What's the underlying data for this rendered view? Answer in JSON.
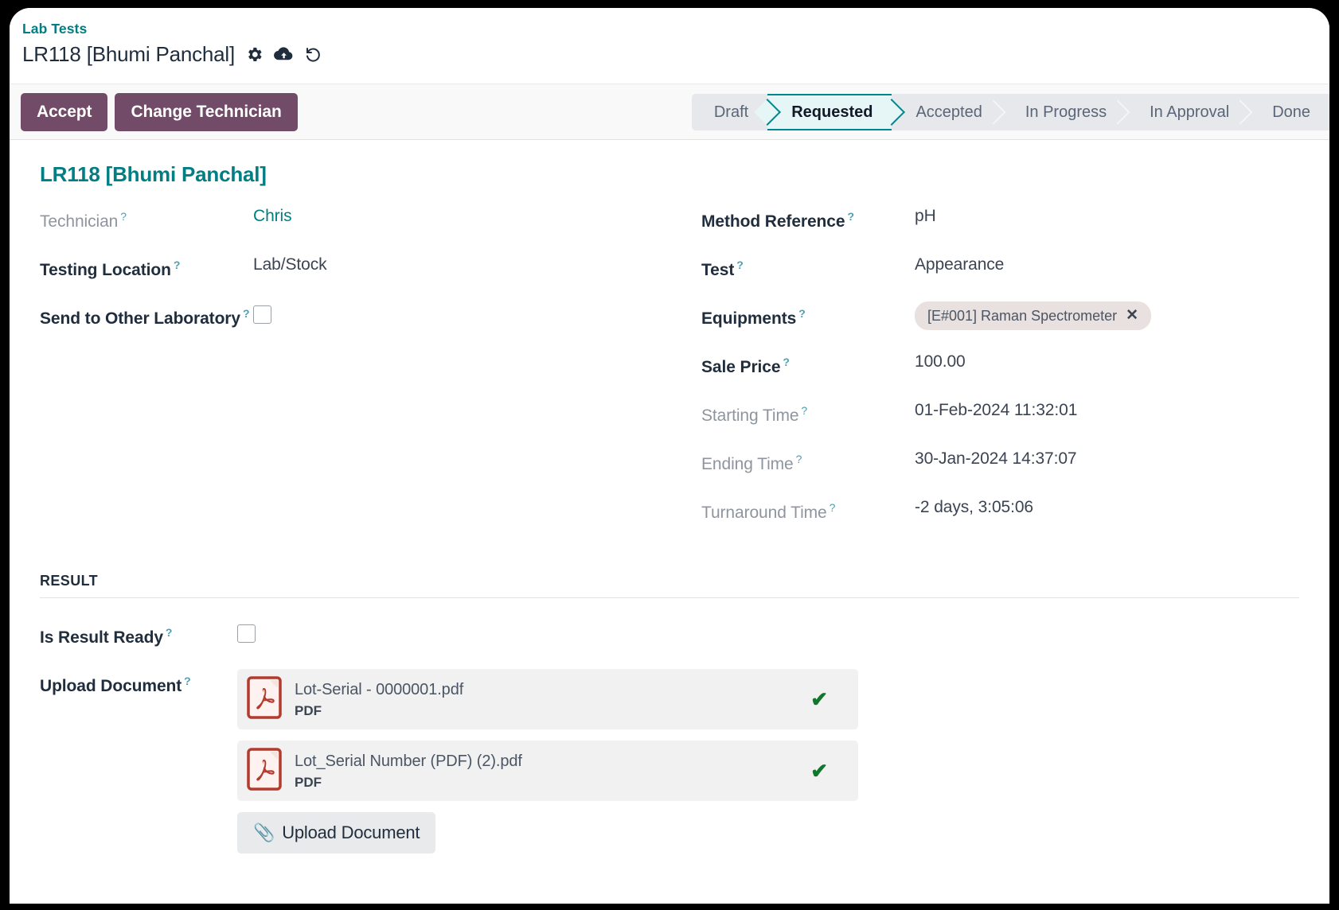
{
  "breadcrumb": {
    "parent": "Lab Tests",
    "record": "LR118 [Bhumi Panchal]",
    "icons": [
      "gear-icon",
      "cloud-upload-icon",
      "undo-icon"
    ]
  },
  "control_panel": {
    "buttons": [
      {
        "label": "Accept",
        "name": "accept-button"
      },
      {
        "label": "Change Technician",
        "name": "change-technician-button"
      }
    ],
    "statusbar": {
      "steps": [
        "Draft",
        "Requested",
        "Accepted",
        "In Progress",
        "In Approval",
        "Done"
      ],
      "active": "Requested"
    }
  },
  "form": {
    "title": "LR118 [Bhumi Panchal]",
    "left_fields": [
      {
        "label": "Technician",
        "value": "Chris",
        "style": "readonly",
        "value_style": "link",
        "type": "text"
      },
      {
        "label": "Testing Location",
        "value": "Lab/Stock",
        "style": "editable",
        "value_style": "text",
        "type": "text"
      },
      {
        "label": "Send to Other Laboratory",
        "value": "",
        "style": "editable",
        "value_style": "text",
        "type": "checkbox",
        "checked": false
      }
    ],
    "right_fields": [
      {
        "label": "Method Reference",
        "value": "pH",
        "style": "editable",
        "type": "text"
      },
      {
        "label": "Test",
        "value": "Appearance",
        "style": "editable",
        "type": "text"
      },
      {
        "label": "Equipments",
        "value": "[E#001] Raman Spectrometer",
        "style": "editable",
        "type": "tag"
      },
      {
        "label": "Sale Price",
        "value": "100.00",
        "style": "editable",
        "type": "text"
      },
      {
        "label": "Starting Time",
        "value": "01-Feb-2024 11:32:01",
        "style": "readonly",
        "type": "text"
      },
      {
        "label": "Ending Time",
        "value": "30-Jan-2024 14:37:07",
        "style": "readonly",
        "type": "text"
      },
      {
        "label": "Turnaround Time",
        "value": "-2 days, 3:05:06",
        "style": "readonly",
        "type": "text"
      }
    ]
  },
  "result": {
    "section_title": "RESULT",
    "is_result_ready": {
      "label": "Is Result Ready",
      "checked": false
    },
    "upload_document": {
      "label": "Upload Document",
      "button_label": "Upload Document",
      "files": [
        {
          "name": "Lot-Serial - 0000001.pdf",
          "type": "PDF",
          "status": "uploaded"
        },
        {
          "name": "Lot_Serial Number (PDF) (2).pdf",
          "type": "PDF",
          "status": "uploaded"
        }
      ]
    }
  },
  "colors": {
    "primary": "#714b67",
    "accent_teal": "#017e84",
    "status_active_border": "#00878d",
    "status_active_bg": "#e6f5f5",
    "tag_bg": "#e9e1df",
    "check_green": "#12762b",
    "pdf_red": "#b23b2e"
  },
  "tooltip_marker": "?"
}
